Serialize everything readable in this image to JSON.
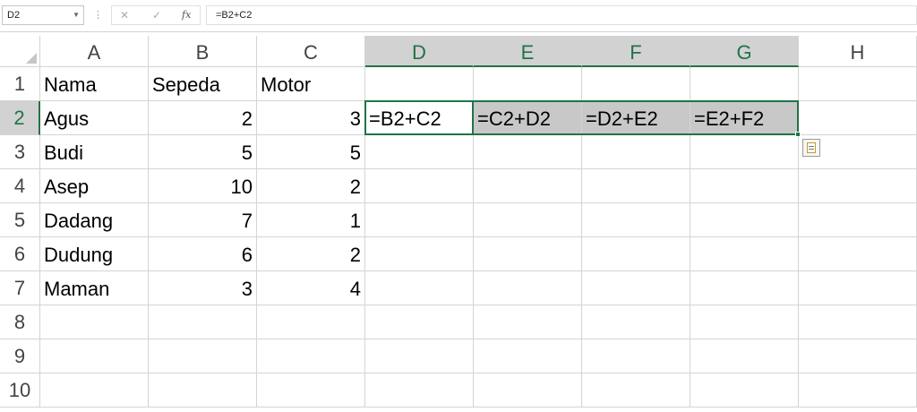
{
  "formula_bar": {
    "name_box": "D2",
    "cancel_icon": "✕",
    "enter_icon": "✓",
    "fx_label": "fx",
    "formula": "=B2+C2"
  },
  "sheet": {
    "columns": [
      "A",
      "B",
      "C",
      "D",
      "E",
      "F",
      "G",
      "H"
    ],
    "rows": [
      "1",
      "2",
      "3",
      "4",
      "5",
      "6",
      "7",
      "8",
      "9",
      "10"
    ],
    "cells": {
      "A1": "Nama",
      "B1": "Sepeda",
      "C1": "Motor",
      "A2": "Agus",
      "B2": "2",
      "C2": "3",
      "D2": "=B2+C2",
      "E2": "=C2+D2",
      "F2": "=D2+E2",
      "G2": "=E2+F2",
      "A3": "Budi",
      "B3": "5",
      "C3": "5",
      "A4": "Asep",
      "B4": "10",
      "C4": "2",
      "A5": "Dadang",
      "B5": "7",
      "C5": "1",
      "A6": "Dudung",
      "B6": "6",
      "C6": "2",
      "A7": "Maman",
      "B7": "3",
      "C7": "4"
    },
    "active_cell": "D2",
    "selected_range": "D2:G2",
    "selected_columns": [
      "D",
      "E",
      "F",
      "G"
    ],
    "selected_rows": [
      "2"
    ],
    "accent_color": "#217346",
    "selection_fill_color": "#c8c8c8",
    "autofill_options_icon": "paste-options-icon"
  }
}
